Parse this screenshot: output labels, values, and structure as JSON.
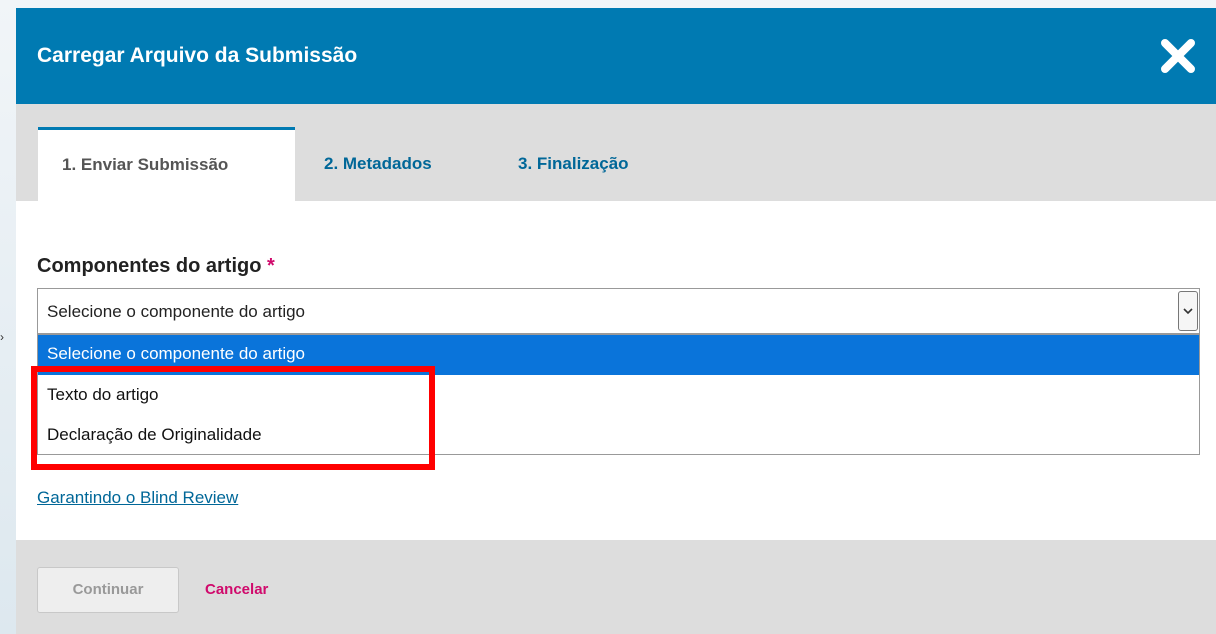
{
  "modal": {
    "title": "Carregar Arquivo da Submissão",
    "close_icon": "close-icon",
    "colors": {
      "header": "#007ab2",
      "link": "#006798",
      "accent": "#d00a6c",
      "highlight": "#ff0000"
    }
  },
  "tabs": [
    {
      "label": "1. Enviar Submissão",
      "active": true
    },
    {
      "label": "2. Metadados",
      "active": false
    },
    {
      "label": "3. Finalização",
      "active": false
    }
  ],
  "form": {
    "label": "Componentes do artigo",
    "required_marker": "*",
    "select": {
      "value": "Selecione o componente do artigo",
      "options": [
        "Selecione o componente do artigo",
        "Texto do artigo",
        "Declaração de Originalidade"
      ],
      "arrow_icon": "chevron-down-icon"
    }
  },
  "links": {
    "blind_review": "Garantindo o Blind Review"
  },
  "footer": {
    "continue_label": "Continuar",
    "cancel_label": "Cancelar"
  }
}
